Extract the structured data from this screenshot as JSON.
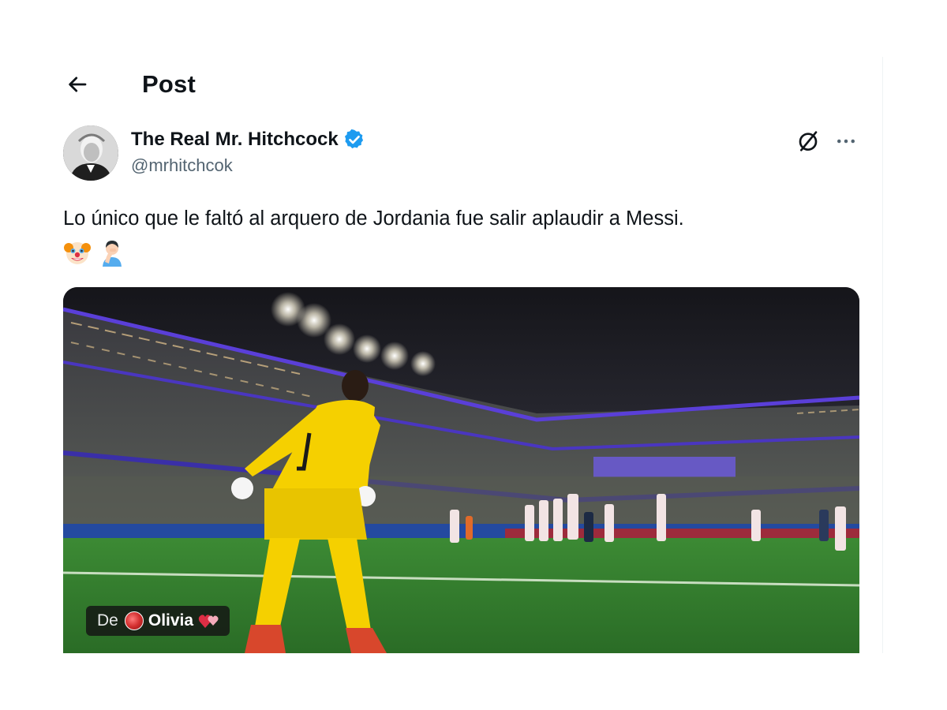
{
  "header": {
    "title": "Post",
    "back_icon": "arrow-left-icon"
  },
  "author": {
    "display_name": "The Real Mr. Hitchcock",
    "handle": "@mrhitchcok",
    "verified": true,
    "verified_color": "#1d9bf0"
  },
  "post": {
    "text": "Lo único que le faltó al arquero de Jordania fue salir aplaudir a Messi.",
    "emojis": [
      "clown-face-emoji",
      "person-facepalming-emoji"
    ]
  },
  "media": {
    "type": "video",
    "attribution": {
      "prefix": "De",
      "name": "Olivia"
    }
  },
  "actions": {
    "grok_icon": "grok-icon",
    "more_icon": "more-horizontal-icon"
  },
  "colors": {
    "text_primary": "#0f1419",
    "text_secondary": "#536471",
    "accent": "#1d9bf0",
    "pitch": "#2f7a2c",
    "keeper_kit": "#f5d000"
  }
}
